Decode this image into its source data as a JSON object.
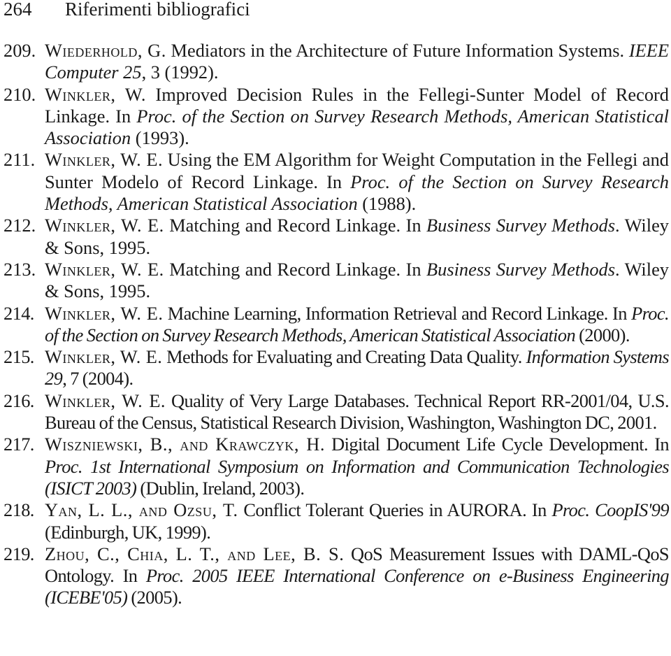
{
  "header": {
    "page_number": "264",
    "section_title": "Riferimenti bibliografici"
  },
  "references": [
    {
      "number": "209.",
      "parts": [
        {
          "style": "sc",
          "text": "Wiederhold, G."
        },
        {
          "style": "normal",
          "text": "  Mediators in the Architecture of Future Information Systems. "
        },
        {
          "style": "it",
          "text": "IEEE Computer 25"
        },
        {
          "style": "normal",
          "text": ", 3 (1992)."
        }
      ]
    },
    {
      "number": "210.",
      "parts": [
        {
          "style": "sc",
          "text": "Winkler, W."
        },
        {
          "style": "normal",
          "text": " Improved Decision Rules in the Fellegi-Sunter Model of Record Linkage. In "
        },
        {
          "style": "it",
          "text": "Proc. of the Section on Survey Research Methods, American Statistical Association"
        },
        {
          "style": "normal",
          "text": " (1993)."
        }
      ]
    },
    {
      "number": "211.",
      "parts": [
        {
          "style": "sc",
          "text": "Winkler, W. E."
        },
        {
          "style": "normal",
          "text": " Using the EM Algorithm for Weight Computation in the Fellegi and Sunter Modelo of Record Linkage. In "
        },
        {
          "style": "it",
          "text": "Proc. of the Section on Survey Research Methods, American Statistical Association"
        },
        {
          "style": "normal",
          "text": " (1988)."
        }
      ]
    },
    {
      "number": "212.",
      "parts": [
        {
          "style": "sc",
          "text": "Winkler, W. E."
        },
        {
          "style": "normal",
          "text": " Matching and Record Linkage. In "
        },
        {
          "style": "it",
          "text": "Business Survey Methods"
        },
        {
          "style": "normal",
          "text": ". Wiley & Sons, 1995."
        }
      ]
    },
    {
      "number": "213.",
      "parts": [
        {
          "style": "sc",
          "text": "Winkler, W. E."
        },
        {
          "style": "normal",
          "text": " Matching and Record Linkage. In "
        },
        {
          "style": "it",
          "text": "Business Survey Methods"
        },
        {
          "style": "normal",
          "text": ". Wiley & Sons, 1995."
        }
      ]
    },
    {
      "number": "214.",
      "parts": [
        {
          "style": "sc",
          "text": "Winkler, W. E."
        },
        {
          "style": "normal",
          "text": " Machine Learning, Information Retrieval and Record Linkage. In "
        },
        {
          "style": "it",
          "text": "Proc. of the Section on Survey Research Methods, American Statistical Association"
        },
        {
          "style": "normal",
          "text": " (2000)."
        }
      ]
    },
    {
      "number": "215.",
      "parts": [
        {
          "style": "sc",
          "text": "Winkler, W. E."
        },
        {
          "style": "normal",
          "text": "  Methods for Evaluating and Creating Data Quality. "
        },
        {
          "style": "it",
          "text": "Information Systems 29"
        },
        {
          "style": "normal",
          "text": ", 7 (2004)."
        }
      ]
    },
    {
      "number": "216.",
      "parts": [
        {
          "style": "sc",
          "text": "Winkler, W. E."
        },
        {
          "style": "normal",
          "text": "  Quality of Very Large Databases.  Technical Report RR-2001/04, U.S. Bureau of the Census, Statistical Research Division, Washington, Washington DC, 2001."
        }
      ]
    },
    {
      "number": "217.",
      "parts": [
        {
          "style": "sc",
          "text": "Wiszniewski, B., and Krawczyk, H."
        },
        {
          "style": "normal",
          "text": "  Digital Document Life Cycle Development.  In "
        },
        {
          "style": "it",
          "text": "Proc. 1st International Symposium on Information and Communication Technologies (ISICT 2003)"
        },
        {
          "style": "normal",
          "text": " (Dublin, Ireland, 2003)."
        }
      ]
    },
    {
      "number": "218.",
      "parts": [
        {
          "style": "sc",
          "text": "Yan, L. L., and Ozsu, T."
        },
        {
          "style": "normal",
          "text": " Conflict Tolerant Queries in AURORA. In "
        },
        {
          "style": "it",
          "text": "Proc. CoopIS'99"
        },
        {
          "style": "normal",
          "text": " (Edinburgh, UK, 1999)."
        }
      ]
    },
    {
      "number": "219.",
      "parts": [
        {
          "style": "sc",
          "text": "Zhou, C., Chia, L. T., and Lee, B. S."
        },
        {
          "style": "normal",
          "text": " QoS Measurement Issues with DAML-QoS Ontology. In "
        },
        {
          "style": "it",
          "text": "Proc. 2005 IEEE International Conference on e-Business Engineering (ICEBE'05)"
        },
        {
          "style": "normal",
          "text": " (2005)."
        }
      ]
    }
  ]
}
